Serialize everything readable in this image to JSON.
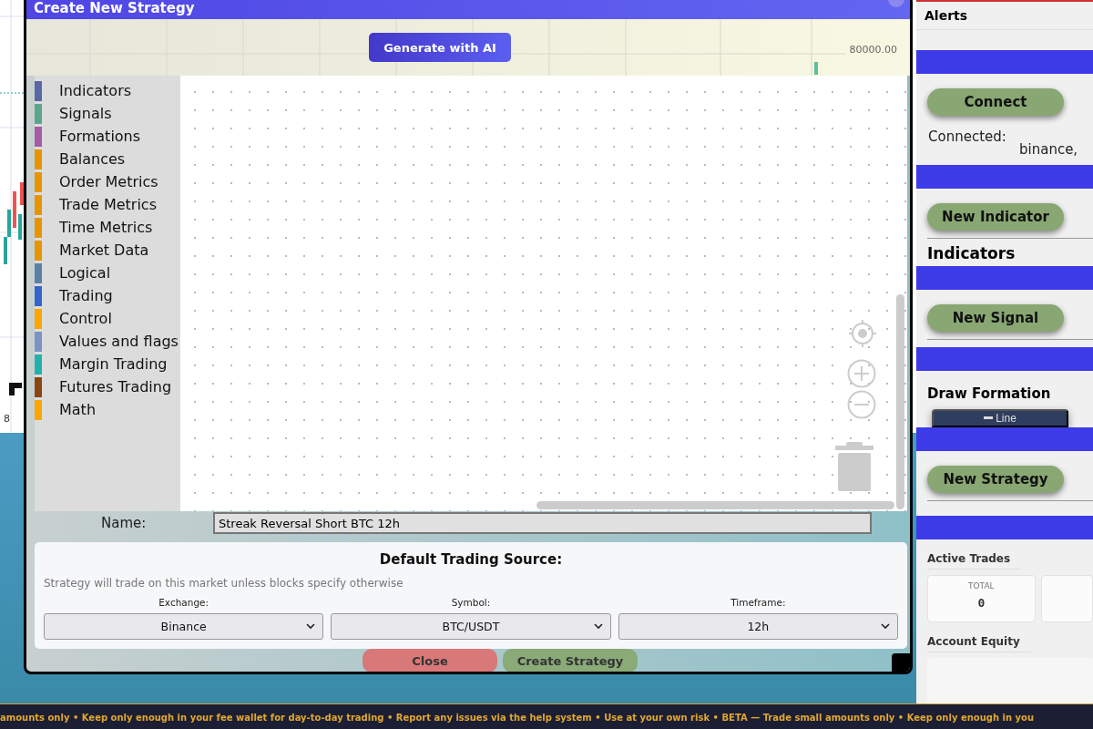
{
  "background_chart": {
    "time_label": "8"
  },
  "sidebar": {
    "header": "Alerts",
    "connect_button": "Connect",
    "connected_label": "Connected:",
    "connected_value": "binance,",
    "new_indicator_button": "New Indicator",
    "indicators_heading": "Indicators",
    "new_signal_button": "New Signal",
    "draw_formation_heading": "Draw Formation",
    "line_button": "Line",
    "new_strategy_button": "New Strategy",
    "active_trades_heading": "Active Trades",
    "stats": [
      {
        "label": "TOTAL",
        "value": "0"
      }
    ],
    "account_equity_heading": "Account Equity"
  },
  "dialog": {
    "title": "Create New Strategy",
    "generate_button": "Generate with AI",
    "price_label": "80000.00",
    "palette": [
      {
        "label": "Indicators",
        "color": "#5b67a5"
      },
      {
        "label": "Signals",
        "color": "#5ba58c"
      },
      {
        "label": "Formations",
        "color": "#a55ba5"
      },
      {
        "label": "Balances",
        "color": "#e69500"
      },
      {
        "label": "Order Metrics",
        "color": "#e69500"
      },
      {
        "label": "Trade Metrics",
        "color": "#e69500"
      },
      {
        "label": "Time Metrics",
        "color": "#e69500"
      },
      {
        "label": "Market Data",
        "color": "#e69500"
      },
      {
        "label": "Logical",
        "color": "#5b80a5"
      },
      {
        "label": "Trading",
        "color": "#3366cc"
      },
      {
        "label": "Control",
        "color": "#ffa500"
      },
      {
        "label": "Values and flags",
        "color": "#7b93c4"
      },
      {
        "label": "Margin Trading",
        "color": "#20b2aa"
      },
      {
        "label": "Futures Trading",
        "color": "#8b4513"
      },
      {
        "label": "Math",
        "color": "#ffa500"
      }
    ],
    "name_label": "Name:",
    "name_value": "Streak Reversal Short BTC 12h",
    "source": {
      "title": "Default Trading Source:",
      "hint": "Strategy will trade on this market unless blocks specify otherwise",
      "fields": [
        {
          "label": "Exchange:",
          "value": "Binance"
        },
        {
          "label": "Symbol:",
          "value": "BTC/USDT"
        },
        {
          "label": "Timeframe:",
          "value": "12h"
        }
      ]
    },
    "buttons": [
      {
        "label": "Close",
        "kind": "danger"
      },
      {
        "label": "Create Strategy",
        "kind": "primary"
      }
    ]
  },
  "ticker": "amounts only • Keep only enough in your fee wallet for day-to-day trading • Report any issues via the help system • Use at your own risk • BETA — Trade small amounts only • Keep only enough in you"
}
